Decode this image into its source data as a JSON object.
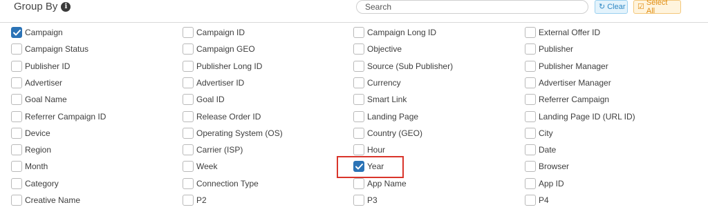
{
  "header": {
    "title": "Group By",
    "search_placeholder": "Search",
    "clear_label": "Clear",
    "select_all_label": "Select All"
  },
  "columns": [
    {
      "items": [
        {
          "label": "Campaign",
          "checked": true
        },
        {
          "label": "Campaign Status",
          "checked": false
        },
        {
          "label": "Publisher ID",
          "checked": false
        },
        {
          "label": "Advertiser",
          "checked": false
        },
        {
          "label": "Goal Name",
          "checked": false
        },
        {
          "label": "Referrer Campaign ID",
          "checked": false
        },
        {
          "label": "Device",
          "checked": false
        },
        {
          "label": "Region",
          "checked": false
        },
        {
          "label": "Month",
          "checked": false
        },
        {
          "label": "Category",
          "checked": false
        },
        {
          "label": "Creative Name",
          "checked": false
        }
      ]
    },
    {
      "items": [
        {
          "label": "Campaign ID",
          "checked": false
        },
        {
          "label": "Campaign GEO",
          "checked": false
        },
        {
          "label": "Publisher Long ID",
          "checked": false
        },
        {
          "label": "Advertiser ID",
          "checked": false
        },
        {
          "label": "Goal ID",
          "checked": false
        },
        {
          "label": "Release Order ID",
          "checked": false
        },
        {
          "label": "Operating System (OS)",
          "checked": false
        },
        {
          "label": "Carrier (ISP)",
          "checked": false
        },
        {
          "label": "Week",
          "checked": false
        },
        {
          "label": "Connection Type",
          "checked": false
        },
        {
          "label": "P2",
          "checked": false
        }
      ]
    },
    {
      "items": [
        {
          "label": "Campaign Long ID",
          "checked": false
        },
        {
          "label": "Objective",
          "checked": false
        },
        {
          "label": "Source (Sub Publisher)",
          "checked": false
        },
        {
          "label": "Currency",
          "checked": false
        },
        {
          "label": "Smart Link",
          "checked": false
        },
        {
          "label": "Landing Page",
          "checked": false
        },
        {
          "label": "Country (GEO)",
          "checked": false
        },
        {
          "label": "Hour",
          "checked": false
        },
        {
          "label": "Year",
          "checked": true
        },
        {
          "label": "App Name",
          "checked": false
        },
        {
          "label": "P3",
          "checked": false
        }
      ]
    },
    {
      "items": [
        {
          "label": "External Offer ID",
          "checked": false
        },
        {
          "label": "Publisher",
          "checked": false
        },
        {
          "label": "Publisher Manager",
          "checked": false
        },
        {
          "label": "Advertiser Manager",
          "checked": false
        },
        {
          "label": "Referrer Campaign",
          "checked": false
        },
        {
          "label": "Landing Page ID (URL ID)",
          "checked": false
        },
        {
          "label": "City",
          "checked": false
        },
        {
          "label": "Date",
          "checked": false
        },
        {
          "label": "Browser",
          "checked": false
        },
        {
          "label": "App ID",
          "checked": false
        },
        {
          "label": "P4",
          "checked": false
        }
      ]
    }
  ],
  "colors": {
    "checked": "#2b73b6",
    "highlight": "#d9342a",
    "clear_accent": "#2e88c4",
    "select_all_accent": "#e08d12"
  }
}
